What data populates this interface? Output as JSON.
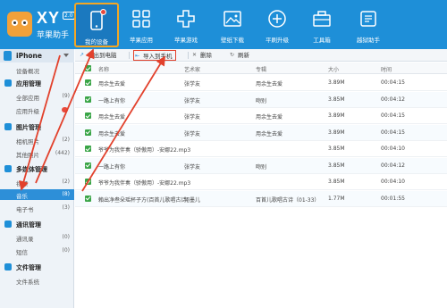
{
  "app": {
    "logo_text": "XY",
    "version": "2.0",
    "name": "苹果助手"
  },
  "nav": [
    {
      "label": "我的设备",
      "icon": "phone-icon",
      "active": true
    },
    {
      "label": "苹果应用",
      "icon": "app-icon",
      "active": false
    },
    {
      "label": "苹果游戏",
      "icon": "game-icon",
      "active": false
    },
    {
      "label": "壁纸下载",
      "icon": "picture-icon",
      "active": false
    },
    {
      "label": "平刷升级",
      "icon": "upgrade-icon",
      "active": false
    },
    {
      "label": "工具箱",
      "icon": "toolbox-icon",
      "active": false
    },
    {
      "label": "越狱助手",
      "icon": "jailbreak-icon",
      "active": false
    }
  ],
  "sidebar": {
    "device": "iPhone",
    "overview": "设备概况",
    "groups": [
      {
        "label": "应用管理",
        "items": [
          {
            "label": "全部应用",
            "count": "(9)"
          },
          {
            "label": "应用升级",
            "count": "",
            "badge": true
          }
        ]
      },
      {
        "label": "图片管理",
        "items": [
          {
            "label": "相机照片",
            "count": "(2)"
          },
          {
            "label": "其他照片",
            "count": "(442)"
          }
        ]
      },
      {
        "label": "多媒体管理",
        "items": [
          {
            "label": "视频",
            "count": "(2)"
          },
          {
            "label": "音乐",
            "count": "(8)",
            "selected": true
          },
          {
            "label": "电子书",
            "count": "(3)"
          }
        ]
      },
      {
        "label": "通讯管理",
        "items": [
          {
            "label": "通讯录",
            "count": "(0)"
          },
          {
            "label": "短信",
            "count": "(0)"
          }
        ]
      },
      {
        "label": "文件管理",
        "items": [
          {
            "label": "文件系统",
            "count": ""
          }
        ]
      }
    ]
  },
  "toolbar": {
    "export": "导出到电脑",
    "import": "导入到手机",
    "delete": "删除",
    "refresh": "刷新"
  },
  "table": {
    "headers": {
      "name": "名称",
      "artist": "艺术家",
      "album": "专辑",
      "size": "大小",
      "duration": "时间"
    },
    "rows": [
      {
        "name": "用余生去爱",
        "artist": "张学友",
        "album": "用余生去爱",
        "size": "3.89M",
        "duration": "00:04:15"
      },
      {
        "name": "一路上有你",
        "artist": "张学友",
        "album": "吻别",
        "size": "3.85M",
        "duration": "00:04:12"
      },
      {
        "name": "用余生去爱",
        "artist": "张学友",
        "album": "用余生去爱",
        "size": "3.89M",
        "duration": "00:04:15"
      },
      {
        "name": "用余生去爱",
        "artist": "张学友",
        "album": "用余生去爱",
        "size": "3.89M",
        "duration": "00:04:15"
      },
      {
        "name": "爷爷为我伴奏（骄傲用）-安娜22.mp3",
        "artist": "",
        "album": "",
        "size": "3.85M",
        "duration": "00:04:10"
      },
      {
        "name": "一路上有你",
        "artist": "张学友",
        "album": "吻别",
        "size": "3.85M",
        "duration": "00:04:12"
      },
      {
        "name": "爷爷为我伴奏（骄傲用）-安娜22.mp3",
        "artist": "",
        "album": "",
        "size": "3.85M",
        "duration": "00:04:10"
      },
      {
        "name": "賴出净叁朵瑶杯子方(百首儿歌唱古诗)",
        "artist": "何墨儿",
        "album": "百首儿歌唱古诗（01-33）",
        "size": "1.77M",
        "duration": "00:01:55"
      }
    ]
  },
  "colors": {
    "header": "#1e8fd8",
    "accent": "#f5a623",
    "highlight": "#e2412c",
    "check": "#3aa547",
    "selected": "#2d8fd8"
  }
}
